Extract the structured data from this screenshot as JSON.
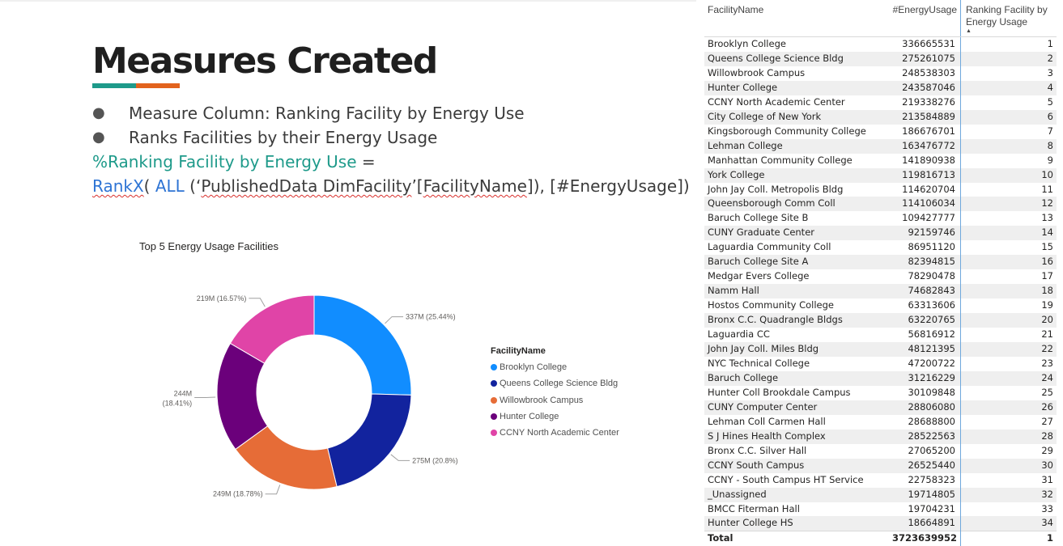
{
  "slide": {
    "title": "Measures Created",
    "bullets": [
      "Measure Column: Ranking Facility by Energy Use",
      "Ranks Facilities by their Energy Usage"
    ],
    "formula": {
      "name": "%Ranking Facility by Energy Use",
      "equals": " =",
      "func": "RankX",
      "paren_open": "( ",
      "all": "ALL",
      "arg_open": " (‘",
      "table_ref": "PublishedData DimFacility",
      "quote_close": "’[",
      "column_ref": "FacilityName",
      "arg_close": "]), [#EnergyUsage])"
    }
  },
  "colors": {
    "accent_teal": "#1e9a8a",
    "accent_orange": "#e2631d",
    "formula_blue": "#2e74d4"
  },
  "chart_data": {
    "type": "pie",
    "title": "Top 5 Energy Usage Facilities",
    "legend_title": "FacilityName",
    "legend_position": "right",
    "categories": [
      "Brooklyn College",
      "Queens College Science Bldg",
      "Willowbrook Campus",
      "Hunter College",
      "CCNY  North Academic Center"
    ],
    "values": [
      336665531,
      275261075,
      248538303,
      243587046,
      219338276
    ],
    "colors": [
      "#118dff",
      "#12239e",
      "#e66c37",
      "#6b007b",
      "#e044a7"
    ],
    "data_labels": [
      "337M (25.44%)",
      "275M (20.8%)",
      "249M (18.78%)",
      "244M (18.41%)",
      "219M (16.57%)"
    ]
  },
  "table": {
    "headers": [
      "FacilityName",
      "#EnergyUsage",
      "Ranking Facility by Energy Usage"
    ],
    "rows": [
      [
        "Brooklyn College",
        "336665531",
        "1"
      ],
      [
        "Queens College Science Bldg",
        "275261075",
        "2"
      ],
      [
        "Willowbrook Campus",
        "248538303",
        "3"
      ],
      [
        "Hunter College",
        "243587046",
        "4"
      ],
      [
        "CCNY North Academic Center",
        "219338276",
        "5"
      ],
      [
        "City College of New York",
        "213584889",
        "6"
      ],
      [
        "Kingsborough Community College",
        "186676701",
        "7"
      ],
      [
        "Lehman College",
        "163476772",
        "8"
      ],
      [
        "Manhattan Community College",
        "141890938",
        "9"
      ],
      [
        "York College",
        "119816713",
        "10"
      ],
      [
        "John Jay Coll. Metropolis Bldg",
        "114620704",
        "11"
      ],
      [
        "Queensborough Comm Coll",
        "114106034",
        "12"
      ],
      [
        "Baruch College Site B",
        "109427777",
        "13"
      ],
      [
        "CUNY Graduate Center",
        "92159746",
        "14"
      ],
      [
        "Laguardia Community Coll",
        "86951120",
        "15"
      ],
      [
        "Baruch College Site A",
        "82394815",
        "16"
      ],
      [
        "Medgar Evers College",
        "78290478",
        "17"
      ],
      [
        "Namm Hall",
        "74682843",
        "18"
      ],
      [
        "Hostos Community College",
        "63313606",
        "19"
      ],
      [
        "Bronx C.C. Quadrangle Bldgs",
        "63220765",
        "20"
      ],
      [
        "Laguardia CC",
        "56816912",
        "21"
      ],
      [
        "John Jay Coll. Miles Bldg",
        "48121395",
        "22"
      ],
      [
        "NYC Technical College",
        "47200722",
        "23"
      ],
      [
        "Baruch College",
        "31216229",
        "24"
      ],
      [
        "Hunter Coll Brookdale Campus",
        "30109848",
        "25"
      ],
      [
        "CUNY Computer Center",
        "28806080",
        "26"
      ],
      [
        "Lehman Coll Carmen Hall",
        "28688800",
        "27"
      ],
      [
        "S J Hines Health Complex",
        "28522563",
        "28"
      ],
      [
        "Bronx C.C. Silver Hall",
        "27065200",
        "29"
      ],
      [
        "CCNY South Campus",
        "26525440",
        "30"
      ],
      [
        "CCNY - South Campus HT Service",
        "22758323",
        "31"
      ],
      [
        "_Unassigned",
        "19714805",
        "32"
      ],
      [
        "BMCC Fiterman Hall",
        "19704231",
        "33"
      ],
      [
        "Hunter College HS",
        "18664891",
        "34"
      ]
    ],
    "total": [
      "Total",
      "3723639952",
      "1"
    ]
  }
}
